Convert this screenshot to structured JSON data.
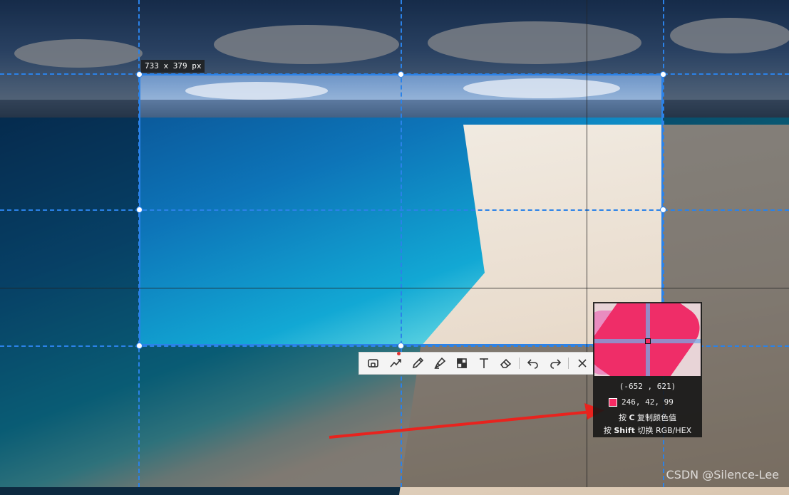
{
  "selection": {
    "size_label": "733 x 379  px"
  },
  "toolbar": {
    "tools": [
      {
        "name": "rectangle-tool",
        "icon": "rectangle-icon"
      },
      {
        "name": "freehand-line-tool",
        "icon": "polyline-icon"
      },
      {
        "name": "pen-tool",
        "icon": "pen-icon"
      },
      {
        "name": "highlighter-tool",
        "icon": "highlighter-icon"
      },
      {
        "name": "mosaic-tool",
        "icon": "mosaic-icon"
      },
      {
        "name": "text-tool",
        "icon": "text-icon"
      },
      {
        "name": "eraser-tool",
        "icon": "eraser-icon"
      },
      {
        "name": "undo-button",
        "icon": "undo-icon"
      },
      {
        "name": "redo-button",
        "icon": "redo-icon"
      },
      {
        "name": "close-button",
        "icon": "close-icon"
      }
    ]
  },
  "magnifier": {
    "coord": "(-652 , 621)",
    "rgb": "246,  42,  99",
    "swatch_color": "#f62a63",
    "tip1_prefix": "按 ",
    "tip1_key": "C",
    "tip1_suffix": " 复制颜色值",
    "tip2_prefix": "按 ",
    "tip2_key": "Shift",
    "tip2_suffix": " 切换 RGB/HEX"
  },
  "watermark": "CSDN @Silence-Lee",
  "colors": {
    "accent": "#2b82e8",
    "arrow": "#e8231e"
  }
}
